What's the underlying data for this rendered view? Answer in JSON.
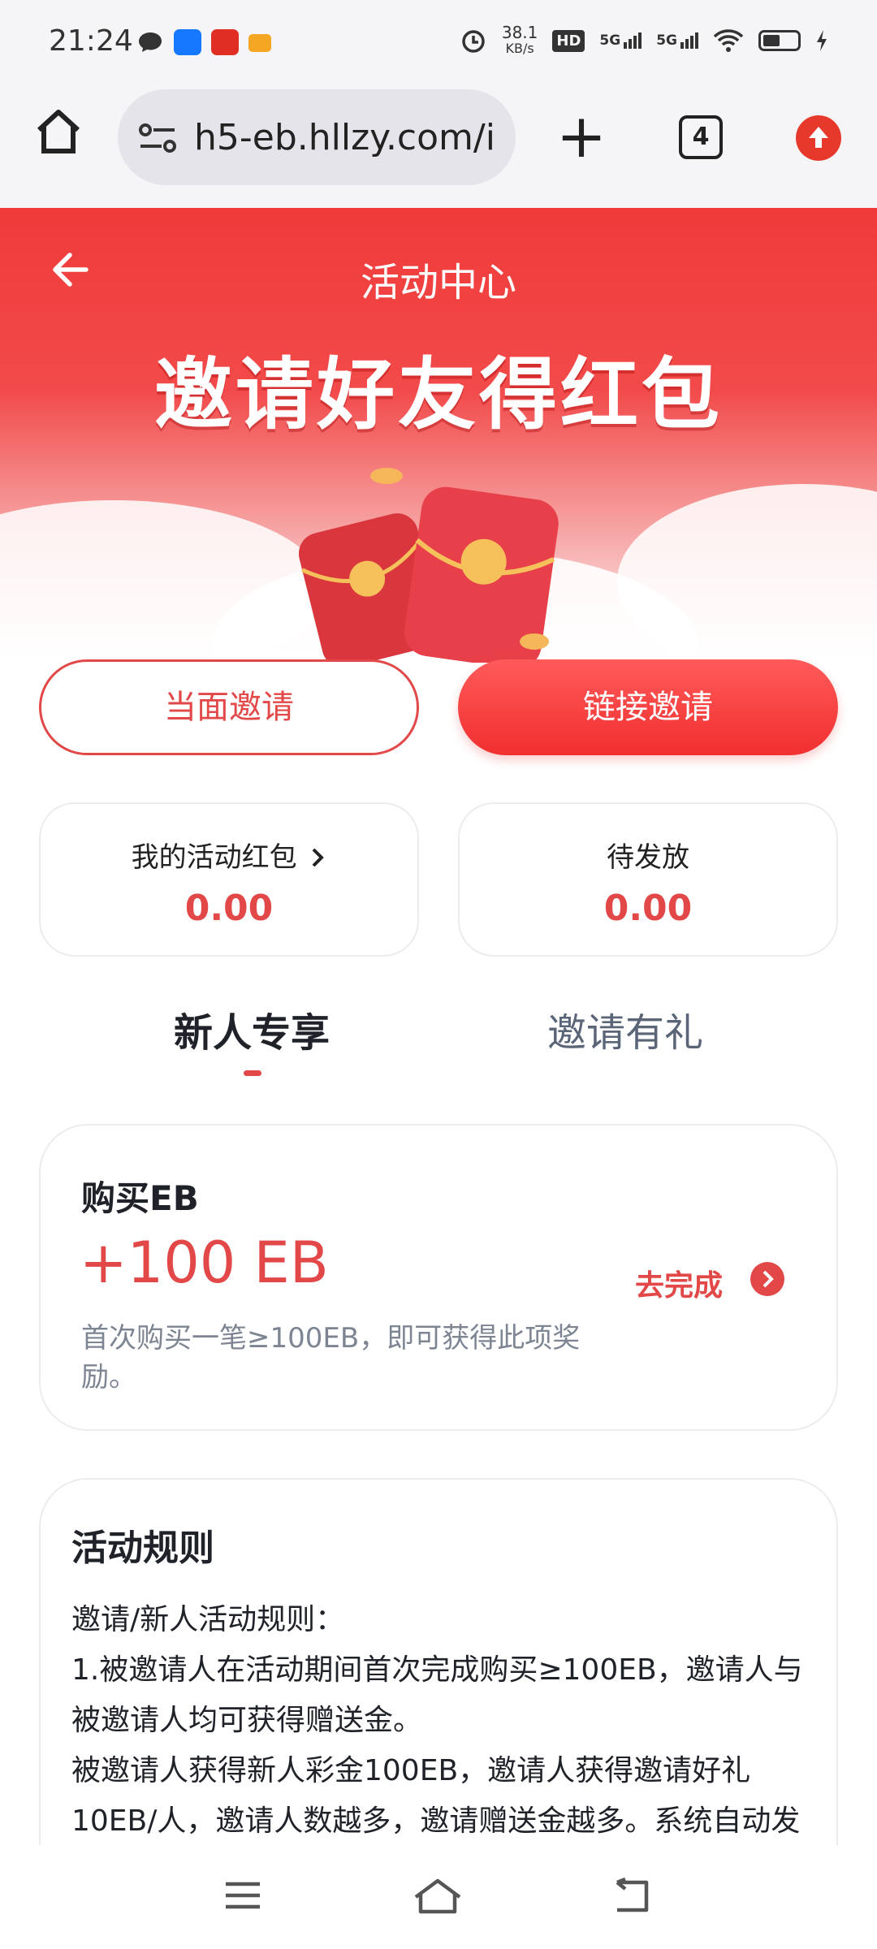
{
  "status_bar": {
    "time": "21:24",
    "net_speed_value": "38.1",
    "net_speed_unit": "KB/s",
    "hd_label": "HD",
    "signal_1": "5G",
    "signal_2": "5G",
    "icons": [
      "message-icon",
      "alipay-icon",
      "pinduoduo-icon",
      "chat-icon",
      "alarm-icon",
      "wifi-icon",
      "battery-icon",
      "charging-icon"
    ]
  },
  "browser": {
    "url": "h5-eb.hllzy.com/i",
    "tab_count": "4"
  },
  "header": {
    "title": "活动中心",
    "banner_headline": "邀请好友得红包"
  },
  "actions": {
    "face_invite": "当面邀请",
    "link_invite": "链接邀请"
  },
  "stats": [
    {
      "label": "我的活动红包",
      "value": "0.00"
    },
    {
      "label": "待发放",
      "value": "0.00"
    }
  ],
  "tabs": [
    {
      "label": "新人专享",
      "active": true
    },
    {
      "label": "邀请有礼",
      "active": false
    }
  ],
  "task": {
    "title": "购买EB",
    "reward": "+100 EB",
    "description": "首次购买一笔≥100EB，即可获得此项奖励。",
    "action": "去完成"
  },
  "rules": {
    "title": "活动规则",
    "lines": [
      "邀请/新人活动规则：",
      "1.被邀请人在活动期间首次完成购买≥100EB，邀请人与被邀请人均可获得赠送金。",
      "被邀请人获得新人彩金100EB，邀请人获得邀请好礼10EB/人，邀请人数越多，邀请赠送金越多。系统自动发放到用户活动红包中。"
    ]
  },
  "colors": {
    "accent": "#e24848",
    "banner_red": "#f03a3a",
    "muted_text": "#7d8593"
  }
}
